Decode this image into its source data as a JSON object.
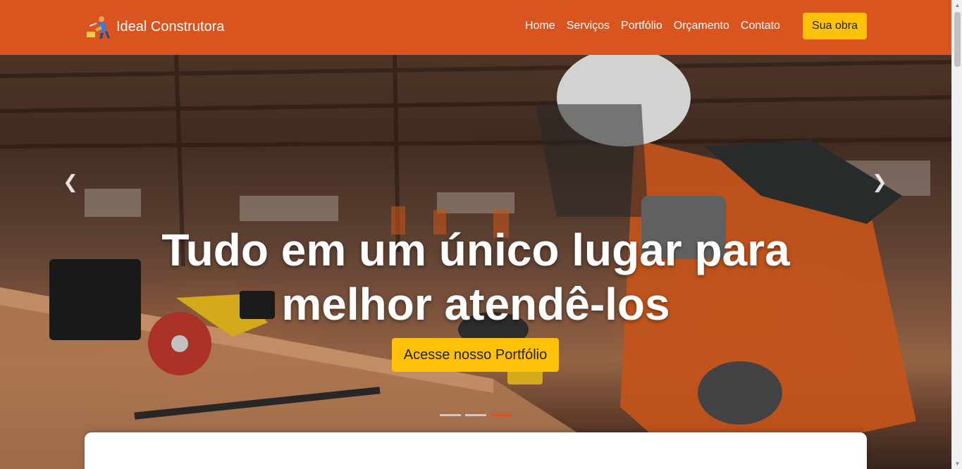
{
  "brand": {
    "name": "Ideal Construtora",
    "logo_icon": "construction-worker-icon"
  },
  "nav": {
    "links": [
      "Home",
      "Serviços",
      "Portfólio",
      "Orçamento",
      "Contato"
    ],
    "cta": "Sua obra"
  },
  "hero": {
    "title": "Tudo em um único lugar para melhor atendê-los",
    "button": "Acesse nosso Portfólio",
    "prev_icon": "chevron-left-icon",
    "next_icon": "chevron-right-icon",
    "slides_count": 3,
    "active_slide": 3
  },
  "colors": {
    "navbar": "#d9541f",
    "accent_button": "#ffc107",
    "indicator_active": "#d9541f"
  }
}
